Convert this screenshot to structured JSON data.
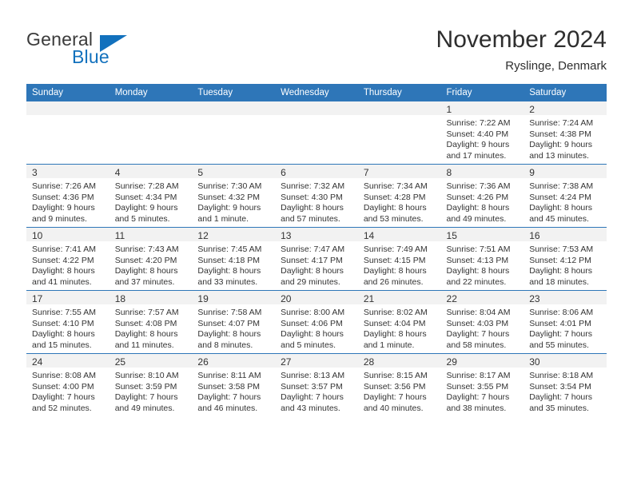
{
  "brand": {
    "word_one": "General",
    "word_two": "Blue",
    "flag_icon": "blue-triangle-flag-icon",
    "accent_color": "#1271bd"
  },
  "header": {
    "title": "November 2024",
    "subtitle": "Ryslinge, Denmark"
  },
  "theme": {
    "header_row_bg": "#2e76b8",
    "daynum_bg": "#f2f2f2",
    "cell_border": "#2e76b8",
    "text": "#333333"
  },
  "calendar": {
    "weekday_headers": [
      "Sunday",
      "Monday",
      "Tuesday",
      "Wednesday",
      "Thursday",
      "Friday",
      "Saturday"
    ],
    "weeks": [
      [
        {
          "empty": true
        },
        {
          "empty": true
        },
        {
          "empty": true
        },
        {
          "empty": true
        },
        {
          "empty": true
        },
        {
          "empty": false,
          "day": "1",
          "sunrise": "Sunrise: 7:22 AM",
          "sunset": "Sunset: 4:40 PM",
          "daylight_line1": "Daylight: 9 hours",
          "daylight_line2": "and 17 minutes."
        },
        {
          "empty": false,
          "day": "2",
          "sunrise": "Sunrise: 7:24 AM",
          "sunset": "Sunset: 4:38 PM",
          "daylight_line1": "Daylight: 9 hours",
          "daylight_line2": "and 13 minutes."
        }
      ],
      [
        {
          "empty": false,
          "day": "3",
          "sunrise": "Sunrise: 7:26 AM",
          "sunset": "Sunset: 4:36 PM",
          "daylight_line1": "Daylight: 9 hours",
          "daylight_line2": "and 9 minutes."
        },
        {
          "empty": false,
          "day": "4",
          "sunrise": "Sunrise: 7:28 AM",
          "sunset": "Sunset: 4:34 PM",
          "daylight_line1": "Daylight: 9 hours",
          "daylight_line2": "and 5 minutes."
        },
        {
          "empty": false,
          "day": "5",
          "sunrise": "Sunrise: 7:30 AM",
          "sunset": "Sunset: 4:32 PM",
          "daylight_line1": "Daylight: 9 hours",
          "daylight_line2": "and 1 minute."
        },
        {
          "empty": false,
          "day": "6",
          "sunrise": "Sunrise: 7:32 AM",
          "sunset": "Sunset: 4:30 PM",
          "daylight_line1": "Daylight: 8 hours",
          "daylight_line2": "and 57 minutes."
        },
        {
          "empty": false,
          "day": "7",
          "sunrise": "Sunrise: 7:34 AM",
          "sunset": "Sunset: 4:28 PM",
          "daylight_line1": "Daylight: 8 hours",
          "daylight_line2": "and 53 minutes."
        },
        {
          "empty": false,
          "day": "8",
          "sunrise": "Sunrise: 7:36 AM",
          "sunset": "Sunset: 4:26 PM",
          "daylight_line1": "Daylight: 8 hours",
          "daylight_line2": "and 49 minutes."
        },
        {
          "empty": false,
          "day": "9",
          "sunrise": "Sunrise: 7:38 AM",
          "sunset": "Sunset: 4:24 PM",
          "daylight_line1": "Daylight: 8 hours",
          "daylight_line2": "and 45 minutes."
        }
      ],
      [
        {
          "empty": false,
          "day": "10",
          "sunrise": "Sunrise: 7:41 AM",
          "sunset": "Sunset: 4:22 PM",
          "daylight_line1": "Daylight: 8 hours",
          "daylight_line2": "and 41 minutes."
        },
        {
          "empty": false,
          "day": "11",
          "sunrise": "Sunrise: 7:43 AM",
          "sunset": "Sunset: 4:20 PM",
          "daylight_line1": "Daylight: 8 hours",
          "daylight_line2": "and 37 minutes."
        },
        {
          "empty": false,
          "day": "12",
          "sunrise": "Sunrise: 7:45 AM",
          "sunset": "Sunset: 4:18 PM",
          "daylight_line1": "Daylight: 8 hours",
          "daylight_line2": "and 33 minutes."
        },
        {
          "empty": false,
          "day": "13",
          "sunrise": "Sunrise: 7:47 AM",
          "sunset": "Sunset: 4:17 PM",
          "daylight_line1": "Daylight: 8 hours",
          "daylight_line2": "and 29 minutes."
        },
        {
          "empty": false,
          "day": "14",
          "sunrise": "Sunrise: 7:49 AM",
          "sunset": "Sunset: 4:15 PM",
          "daylight_line1": "Daylight: 8 hours",
          "daylight_line2": "and 26 minutes."
        },
        {
          "empty": false,
          "day": "15",
          "sunrise": "Sunrise: 7:51 AM",
          "sunset": "Sunset: 4:13 PM",
          "daylight_line1": "Daylight: 8 hours",
          "daylight_line2": "and 22 minutes."
        },
        {
          "empty": false,
          "day": "16",
          "sunrise": "Sunrise: 7:53 AM",
          "sunset": "Sunset: 4:12 PM",
          "daylight_line1": "Daylight: 8 hours",
          "daylight_line2": "and 18 minutes."
        }
      ],
      [
        {
          "empty": false,
          "day": "17",
          "sunrise": "Sunrise: 7:55 AM",
          "sunset": "Sunset: 4:10 PM",
          "daylight_line1": "Daylight: 8 hours",
          "daylight_line2": "and 15 minutes."
        },
        {
          "empty": false,
          "day": "18",
          "sunrise": "Sunrise: 7:57 AM",
          "sunset": "Sunset: 4:08 PM",
          "daylight_line1": "Daylight: 8 hours",
          "daylight_line2": "and 11 minutes."
        },
        {
          "empty": false,
          "day": "19",
          "sunrise": "Sunrise: 7:58 AM",
          "sunset": "Sunset: 4:07 PM",
          "daylight_line1": "Daylight: 8 hours",
          "daylight_line2": "and 8 minutes."
        },
        {
          "empty": false,
          "day": "20",
          "sunrise": "Sunrise: 8:00 AM",
          "sunset": "Sunset: 4:06 PM",
          "daylight_line1": "Daylight: 8 hours",
          "daylight_line2": "and 5 minutes."
        },
        {
          "empty": false,
          "day": "21",
          "sunrise": "Sunrise: 8:02 AM",
          "sunset": "Sunset: 4:04 PM",
          "daylight_line1": "Daylight: 8 hours",
          "daylight_line2": "and 1 minute."
        },
        {
          "empty": false,
          "day": "22",
          "sunrise": "Sunrise: 8:04 AM",
          "sunset": "Sunset: 4:03 PM",
          "daylight_line1": "Daylight: 7 hours",
          "daylight_line2": "and 58 minutes."
        },
        {
          "empty": false,
          "day": "23",
          "sunrise": "Sunrise: 8:06 AM",
          "sunset": "Sunset: 4:01 PM",
          "daylight_line1": "Daylight: 7 hours",
          "daylight_line2": "and 55 minutes."
        }
      ],
      [
        {
          "empty": false,
          "day": "24",
          "sunrise": "Sunrise: 8:08 AM",
          "sunset": "Sunset: 4:00 PM",
          "daylight_line1": "Daylight: 7 hours",
          "daylight_line2": "and 52 minutes."
        },
        {
          "empty": false,
          "day": "25",
          "sunrise": "Sunrise: 8:10 AM",
          "sunset": "Sunset: 3:59 PM",
          "daylight_line1": "Daylight: 7 hours",
          "daylight_line2": "and 49 minutes."
        },
        {
          "empty": false,
          "day": "26",
          "sunrise": "Sunrise: 8:11 AM",
          "sunset": "Sunset: 3:58 PM",
          "daylight_line1": "Daylight: 7 hours",
          "daylight_line2": "and 46 minutes."
        },
        {
          "empty": false,
          "day": "27",
          "sunrise": "Sunrise: 8:13 AM",
          "sunset": "Sunset: 3:57 PM",
          "daylight_line1": "Daylight: 7 hours",
          "daylight_line2": "and 43 minutes."
        },
        {
          "empty": false,
          "day": "28",
          "sunrise": "Sunrise: 8:15 AM",
          "sunset": "Sunset: 3:56 PM",
          "daylight_line1": "Daylight: 7 hours",
          "daylight_line2": "and 40 minutes."
        },
        {
          "empty": false,
          "day": "29",
          "sunrise": "Sunrise: 8:17 AM",
          "sunset": "Sunset: 3:55 PM",
          "daylight_line1": "Daylight: 7 hours",
          "daylight_line2": "and 38 minutes."
        },
        {
          "empty": false,
          "day": "30",
          "sunrise": "Sunrise: 8:18 AM",
          "sunset": "Sunset: 3:54 PM",
          "daylight_line1": "Daylight: 7 hours",
          "daylight_line2": "and 35 minutes."
        }
      ]
    ]
  }
}
